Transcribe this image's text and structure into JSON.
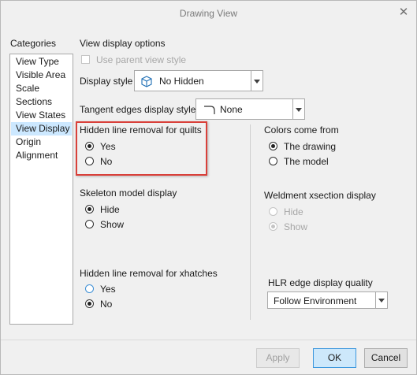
{
  "window": {
    "title": "Drawing View"
  },
  "categories": {
    "heading": "Categories",
    "items": [
      "View Type",
      "Visible Area",
      "Scale",
      "Sections",
      "View States",
      "View Display",
      "Origin",
      "Alignment"
    ],
    "selected": "View Display"
  },
  "options": {
    "heading": "View display options",
    "use_parent_style_label": "Use parent view style",
    "display_style_label": "Display style",
    "display_style_value": "No Hidden",
    "tangent_label": "Tangent edges display style",
    "tangent_value": "None"
  },
  "hidden_quilts": {
    "heading": "Hidden line removal for quilts",
    "yes": "Yes",
    "no": "No",
    "selected": "Yes"
  },
  "skeleton": {
    "heading": "Skeleton model display",
    "hide": "Hide",
    "show": "Show",
    "selected": "Hide"
  },
  "hidden_xhatch": {
    "heading": "Hidden line removal for xhatches",
    "yes": "Yes",
    "no": "No",
    "selected": "No"
  },
  "colors": {
    "heading": "Colors come from",
    "drawing": "The drawing",
    "model": "The model",
    "selected": "The drawing"
  },
  "weldment": {
    "heading": "Weldment xsection display",
    "hide": "Hide",
    "show": "Show",
    "selected": "Show"
  },
  "hlr_quality": {
    "heading": "HLR edge display quality",
    "value": "Follow Environment"
  },
  "buttons": {
    "apply": "Apply",
    "ok": "OK",
    "cancel": "Cancel"
  },
  "colors_ui": {
    "highlight": "#d9403a",
    "selection": "#cce8ff",
    "ok_border": "#3c97dd"
  }
}
